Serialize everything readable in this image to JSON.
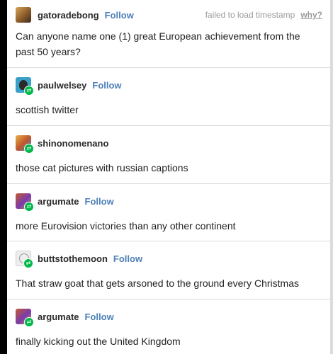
{
  "original_post": {
    "username": "gatoradebong",
    "follow_label": "Follow",
    "timestamp_text": "failed to load timestamp",
    "why_label": "why?",
    "avatar_icon": "user-avatar-icon",
    "text": "Can anyone name one (1) great European achievement from the past 50 years?"
  },
  "replies": [
    {
      "username": "paulwelsey",
      "follow_label": "Follow",
      "text": "scottish twitter",
      "badge_icon": "reblog-icon"
    },
    {
      "username": "shinonomenano",
      "follow_label": "",
      "text": "those cat pictures with russian captions",
      "badge_icon": "reblog-icon"
    },
    {
      "username": "argumate",
      "follow_label": "Follow",
      "text": "more Eurovision victories than any other continent",
      "badge_icon": "reblog-icon"
    },
    {
      "username": "buttstothemoon",
      "follow_label": "Follow",
      "text": "That straw goat that gets arsoned to the ground every Christmas",
      "badge_icon": "reblog-icon"
    },
    {
      "username": "argumate",
      "follow_label": "Follow",
      "text": "finally kicking out the United Kingdom",
      "badge_icon": "reblog-icon"
    }
  ],
  "colors": {
    "follow_link": "#4d7fb8",
    "reblog_badge": "#00b84a",
    "divider": "#d9d9d9",
    "muted_text": "#9a9a9a"
  },
  "reblog_glyph": "⇄"
}
